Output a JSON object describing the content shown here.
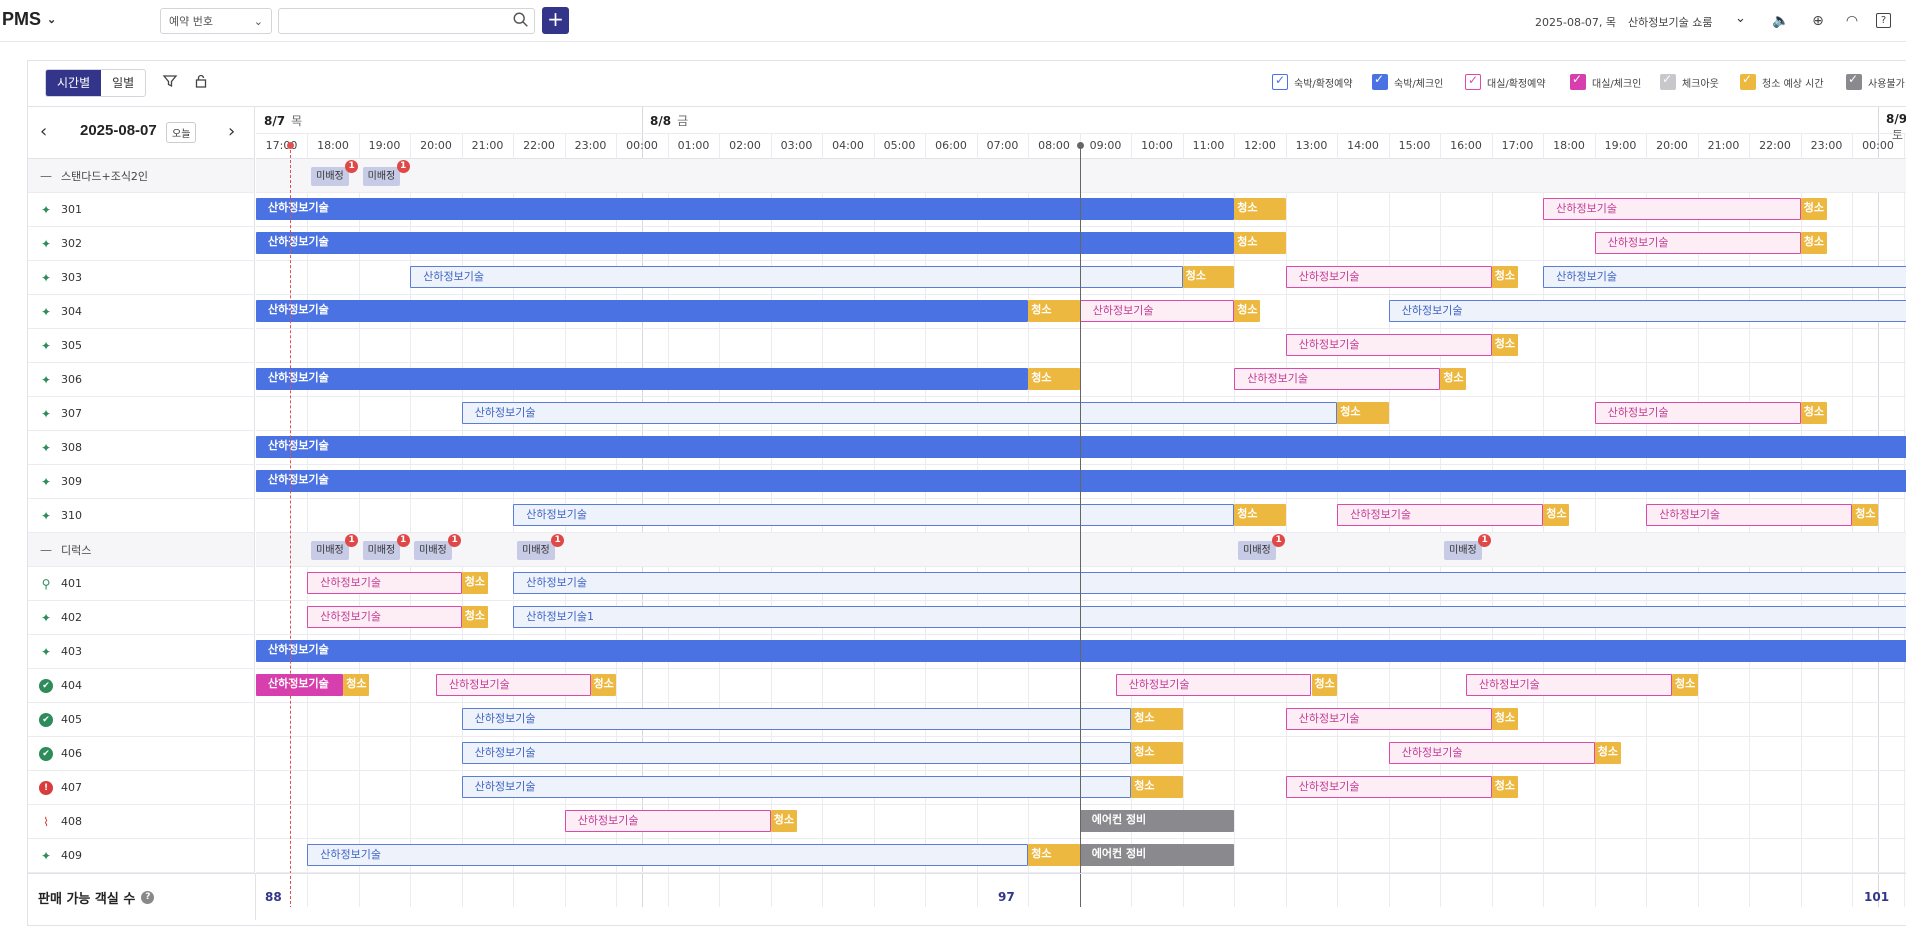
{
  "app": {
    "title": "PMS"
  },
  "search": {
    "type_select": "예약 번호",
    "placeholder": ""
  },
  "header": {
    "date": "2025-08-07, 목",
    "hotel": "산하정보기술 쇼룸"
  },
  "toolbar": {
    "tab_time": "시간별",
    "tab_day": "일별"
  },
  "legend": [
    {
      "label": "숙박/확정예약",
      "color": "#4a72e2",
      "filled": false
    },
    {
      "label": "숙박/체크인",
      "color": "#4a72e2",
      "filled": true
    },
    {
      "label": "대실/확정예약",
      "color": "#dc4aa8",
      "filled": false
    },
    {
      "label": "대실/체크인",
      "color": "#d83fae",
      "filled": true
    },
    {
      "label": "체크아웃",
      "color": "#c8c8cc",
      "filled": true
    },
    {
      "label": "청소 예상 시간",
      "color": "#ecb840",
      "filled": true
    },
    {
      "label": "사용불가",
      "color": "#8a8a8e",
      "filled": true
    }
  ],
  "nav": {
    "date": "2025-08-07",
    "today": "오늘"
  },
  "days": [
    {
      "date": "8/7",
      "dow": "목"
    },
    {
      "date": "8/8",
      "dow": "금"
    },
    {
      "date": "8/9",
      "dow": "토"
    }
  ],
  "hours": [
    "17:00",
    "18:00",
    "19:00",
    "20:00",
    "21:00",
    "22:00",
    "23:00",
    "00:00",
    "01:00",
    "02:00",
    "03:00",
    "04:00",
    "05:00",
    "06:00",
    "07:00",
    "08:00",
    "09:00",
    "10:00",
    "11:00",
    "12:00",
    "13:00",
    "14:00",
    "15:00",
    "16:00",
    "17:00",
    "18:00",
    "19:00",
    "20:00",
    "21:00",
    "22:00",
    "23:00",
    "00:00"
  ],
  "rows": [
    {
      "kind": "group",
      "label": "스탠다드+조식2인",
      "unassigned": [
        {
          "label": "미배정",
          "count": "1",
          "h": 1.1
        },
        {
          "label": "미배정",
          "count": "1",
          "h": 2.1
        }
      ]
    },
    {
      "kind": "room",
      "label": "301",
      "status": "sparkle",
      "bars": [
        {
          "s": -0.8,
          "e": 18.5,
          "t": "b-blue",
          "label": "산하정보기술"
        },
        {
          "s": 18.5,
          "e": 19.5,
          "t": "b-clean",
          "label": "청소"
        },
        {
          "s": 24.5,
          "e": 29.5,
          "t": "b-pinkout",
          "label": "산하정보기술"
        },
        {
          "s": 29.5,
          "e": 30.0,
          "t": "b-clean",
          "label": "청소"
        }
      ]
    },
    {
      "kind": "room",
      "label": "302",
      "status": "sparkle",
      "bars": [
        {
          "s": -0.8,
          "e": 18.5,
          "t": "b-blue",
          "label": "산하정보기술"
        },
        {
          "s": 18.5,
          "e": 19.5,
          "t": "b-clean",
          "label": "청소"
        },
        {
          "s": 25.5,
          "e": 29.5,
          "t": "b-pinkout",
          "label": "산하정보기술"
        },
        {
          "s": 29.5,
          "e": 30.0,
          "t": "b-clean",
          "label": "청소"
        }
      ]
    },
    {
      "kind": "room",
      "label": "303",
      "status": "sparkle",
      "bars": [
        {
          "s": 2.5,
          "e": 17.5,
          "t": "b-blueout",
          "label": "산하정보기술"
        },
        {
          "s": 17.5,
          "e": 18.5,
          "t": "b-clean",
          "label": "청소"
        },
        {
          "s": 19.5,
          "e": 23.5,
          "t": "b-pinkout",
          "label": "산하정보기술"
        },
        {
          "s": 23.5,
          "e": 24.0,
          "t": "b-clean",
          "label": "청소"
        },
        {
          "s": 24.5,
          "e": 32.0,
          "t": "b-blueout",
          "label": "산하정보기술"
        }
      ]
    },
    {
      "kind": "room",
      "label": "304",
      "status": "sparkle",
      "bars": [
        {
          "s": -0.6,
          "e": 14.5,
          "t": "b-blue",
          "label": "산하정보기술"
        },
        {
          "s": 14.5,
          "e": 15.5,
          "t": "b-clean",
          "label": "청소"
        },
        {
          "s": 15.5,
          "e": 18.5,
          "t": "b-pinkout",
          "label": "산하정보기술"
        },
        {
          "s": 18.5,
          "e": 19.0,
          "t": "b-clean",
          "label": "청소"
        },
        {
          "s": 21.5,
          "e": 32.0,
          "t": "b-blueout",
          "label": "산하정보기술"
        }
      ]
    },
    {
      "kind": "room",
      "label": "305",
      "status": "sparkle",
      "bars": [
        {
          "s": 19.5,
          "e": 23.5,
          "t": "b-pinkout",
          "label": "산하정보기술"
        },
        {
          "s": 23.5,
          "e": 24.0,
          "t": "b-clean",
          "label": "청소"
        }
      ]
    },
    {
      "kind": "room",
      "label": "306",
      "status": "sparkle",
      "bars": [
        {
          "s": -0.8,
          "e": 14.5,
          "t": "b-blue",
          "label": "산하정보기술"
        },
        {
          "s": 14.5,
          "e": 15.5,
          "t": "b-clean",
          "label": "청소"
        },
        {
          "s": 18.5,
          "e": 22.5,
          "t": "b-pinkout",
          "label": "산하정보기술"
        },
        {
          "s": 22.5,
          "e": 23.0,
          "t": "b-clean",
          "label": "청소"
        }
      ]
    },
    {
      "kind": "room",
      "label": "307",
      "status": "sparkle",
      "bars": [
        {
          "s": 3.5,
          "e": 20.5,
          "t": "b-blueout",
          "label": "산하정보기술"
        },
        {
          "s": 20.5,
          "e": 21.5,
          "t": "b-clean",
          "label": "청소"
        },
        {
          "s": 25.5,
          "e": 29.5,
          "t": "b-pinkout",
          "label": "산하정보기술"
        },
        {
          "s": 29.5,
          "e": 30.0,
          "t": "b-clean",
          "label": "청소"
        }
      ]
    },
    {
      "kind": "room",
      "label": "308",
      "status": "sparkle",
      "bars": [
        {
          "s": -0.8,
          "e": 32.0,
          "t": "b-blue",
          "label": "산하정보기술"
        }
      ]
    },
    {
      "kind": "room",
      "label": "309",
      "status": "sparkle",
      "bars": [
        {
          "s": -0.8,
          "e": 32.0,
          "t": "b-blue",
          "label": "산하정보기술"
        }
      ]
    },
    {
      "kind": "room",
      "label": "310",
      "status": "sparkle",
      "bars": [
        {
          "s": 4.5,
          "e": 18.5,
          "t": "b-blueout",
          "label": "산하정보기술"
        },
        {
          "s": 18.5,
          "e": 19.5,
          "t": "b-clean",
          "label": "청소"
        },
        {
          "s": 20.5,
          "e": 24.5,
          "t": "b-pinkout",
          "label": "산하정보기술"
        },
        {
          "s": 24.5,
          "e": 25.0,
          "t": "b-clean",
          "label": "청소"
        },
        {
          "s": 26.5,
          "e": 30.5,
          "t": "b-pinkout",
          "label": "산하정보기술"
        },
        {
          "s": 30.5,
          "e": 31.0,
          "t": "b-clean",
          "label": "청소"
        }
      ]
    },
    {
      "kind": "group",
      "label": "디럭스",
      "unassigned": [
        {
          "label": "미배정",
          "count": "1",
          "h": 1.1
        },
        {
          "label": "미배정",
          "count": "1",
          "h": 2.1
        },
        {
          "label": "미배정",
          "count": "1",
          "h": 3.1
        },
        {
          "label": "미배정",
          "count": "1",
          "h": 5.1
        },
        {
          "label": "미배정",
          "count": "1",
          "h": 19.1
        },
        {
          "label": "미배정",
          "count": "1",
          "h": 23.1
        }
      ]
    },
    {
      "kind": "room",
      "label": "401",
      "status": "search",
      "bars": [
        {
          "s": 0.5,
          "e": 3.5,
          "t": "b-pinkout",
          "label": "산하정보기술"
        },
        {
          "s": 3.5,
          "e": 4.0,
          "t": "b-clean",
          "label": "청소"
        },
        {
          "s": 4.5,
          "e": 32.0,
          "t": "b-blueout",
          "label": "산하정보기술"
        }
      ]
    },
    {
      "kind": "room",
      "label": "402",
      "status": "sparkle",
      "bars": [
        {
          "s": 0.5,
          "e": 3.5,
          "t": "b-pinkout",
          "label": "산하정보기술"
        },
        {
          "s": 3.5,
          "e": 4.0,
          "t": "b-clean",
          "label": "청소"
        },
        {
          "s": 4.5,
          "e": 32.0,
          "t": "b-blueout",
          "label": "산하정보기술1"
        }
      ]
    },
    {
      "kind": "room",
      "label": "403",
      "status": "sparkle",
      "bars": [
        {
          "s": -0.8,
          "e": 32.0,
          "t": "b-blue",
          "label": "산하정보기술"
        }
      ]
    },
    {
      "kind": "room",
      "label": "404",
      "status": "check",
      "bars": [
        {
          "s": -1.0,
          "e": 1.2,
          "t": "b-mag",
          "label": "산하정보기술"
        },
        {
          "s": 1.2,
          "e": 1.7,
          "t": "b-clean",
          "label": "청소"
        },
        {
          "s": 3.0,
          "e": 6.0,
          "t": "b-pinkout",
          "label": "산하정보기술"
        },
        {
          "s": 6.0,
          "e": 6.5,
          "t": "b-clean",
          "label": "청소"
        },
        {
          "s": 16.2,
          "e": 20.0,
          "t": "b-pinkout",
          "label": "산하정보기술"
        },
        {
          "s": 20.0,
          "e": 20.5,
          "t": "b-clean",
          "label": "청소"
        },
        {
          "s": 23.0,
          "e": 27.0,
          "t": "b-pinkout",
          "label": "산하정보기술"
        },
        {
          "s": 27.0,
          "e": 27.5,
          "t": "b-clean",
          "label": "청소"
        }
      ]
    },
    {
      "kind": "room",
      "label": "405",
      "status": "check",
      "bars": [
        {
          "s": 3.5,
          "e": 16.5,
          "t": "b-blueout",
          "label": "산하정보기술"
        },
        {
          "s": 16.5,
          "e": 17.5,
          "t": "b-clean",
          "label": "청소"
        },
        {
          "s": 19.5,
          "e": 23.5,
          "t": "b-pinkout",
          "label": "산하정보기술"
        },
        {
          "s": 23.5,
          "e": 24.0,
          "t": "b-clean",
          "label": "청소"
        }
      ]
    },
    {
      "kind": "room",
      "label": "406",
      "status": "check",
      "bars": [
        {
          "s": 3.5,
          "e": 16.5,
          "t": "b-blueout",
          "label": "산하정보기술"
        },
        {
          "s": 16.5,
          "e": 17.5,
          "t": "b-clean",
          "label": "청소"
        },
        {
          "s": 21.5,
          "e": 25.5,
          "t": "b-pinkout",
          "label": "산하정보기술"
        },
        {
          "s": 25.5,
          "e": 26.0,
          "t": "b-clean",
          "label": "청소"
        }
      ]
    },
    {
      "kind": "room",
      "label": "407",
      "status": "alert",
      "bars": [
        {
          "s": 3.5,
          "e": 16.5,
          "t": "b-blueout",
          "label": "산하정보기술"
        },
        {
          "s": 16.5,
          "e": 17.5,
          "t": "b-clean",
          "label": "청소"
        },
        {
          "s": 19.5,
          "e": 23.5,
          "t": "b-pinkout",
          "label": "산하정보기술"
        },
        {
          "s": 23.5,
          "e": 24.0,
          "t": "b-clean",
          "label": "청소"
        }
      ]
    },
    {
      "kind": "room",
      "label": "408",
      "status": "broom",
      "bars": [
        {
          "s": 5.5,
          "e": 9.5,
          "t": "b-pinkout",
          "label": "산하정보기술"
        },
        {
          "s": 9.5,
          "e": 10.0,
          "t": "b-clean",
          "label": "청소"
        },
        {
          "s": 15.5,
          "e": 18.5,
          "t": "b-gray",
          "label": "에어컨 정비"
        }
      ]
    },
    {
      "kind": "room",
      "label": "409",
      "status": "sparkle",
      "bars": [
        {
          "s": 0.5,
          "e": 14.5,
          "t": "b-blueout",
          "label": "산하정보기술"
        },
        {
          "s": 14.5,
          "e": 15.5,
          "t": "b-clean",
          "label": "청소"
        },
        {
          "s": 15.5,
          "e": 18.5,
          "t": "b-gray",
          "label": "에어컨 정비"
        }
      ]
    }
  ],
  "footer": {
    "label": "판매 가능 객실 수",
    "values": [
      "88",
      "97",
      "101"
    ]
  }
}
